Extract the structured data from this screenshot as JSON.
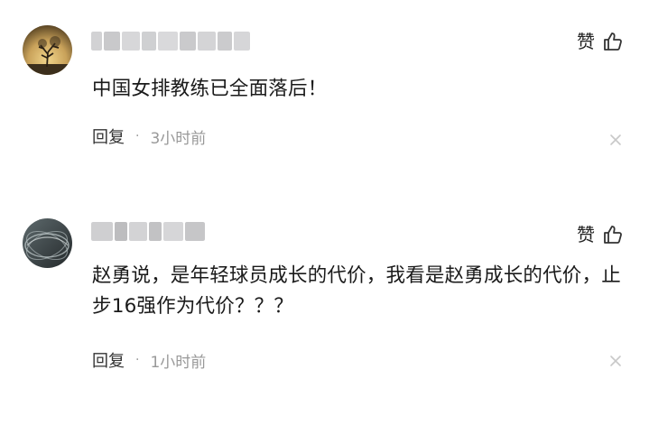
{
  "comments": [
    {
      "username": "",
      "like_label": "赞",
      "text": "中国女排教练已全面落后！",
      "reply_label": "回复",
      "separator": "·",
      "time": "3小时前"
    },
    {
      "username": "",
      "like_label": "赞",
      "text": "赵勇说，是年轻球员成长的代价，我看是赵勇成长的代价，止步16强作为代价？？？",
      "reply_label": "回复",
      "separator": "·",
      "time": "1小时前"
    }
  ],
  "icons": {
    "like": "thumbs-up-icon",
    "close": "close-icon"
  },
  "colors": {
    "text": "#1a1a1a",
    "meta": "#999999",
    "icon": "#333333"
  }
}
